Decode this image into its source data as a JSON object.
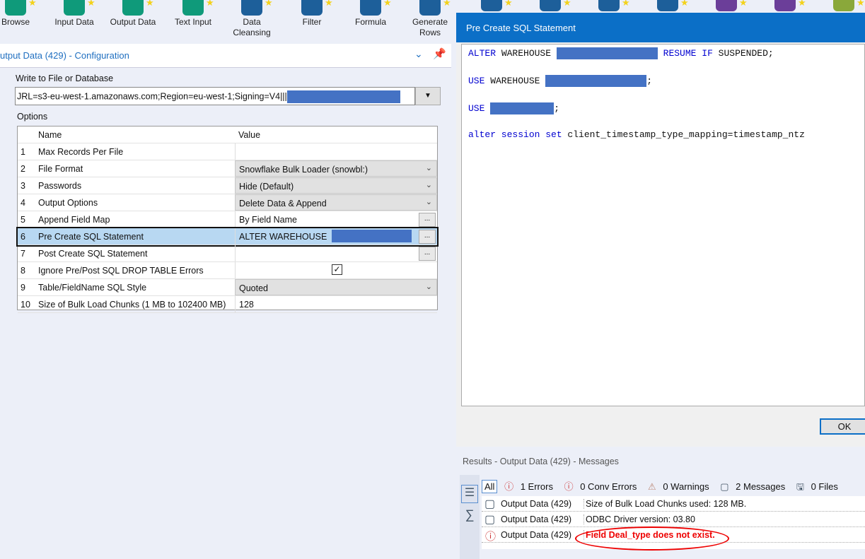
{
  "toolbar": {
    "tools": [
      {
        "label": "Browse",
        "color": "#0f9a7a"
      },
      {
        "label": "Input Data",
        "color": "#0f9a7a"
      },
      {
        "label": "Output Data",
        "color": "#0f9a7a"
      },
      {
        "label": "Text Input",
        "color": "#0f9a7a"
      },
      {
        "label": "Data Cleansing",
        "color": "#1d5f9a"
      },
      {
        "label": "Filter",
        "color": "#1d5f9a"
      },
      {
        "label": "Formula",
        "color": "#1d5f9a"
      },
      {
        "label": "Generate Rows",
        "color": "#1d5f9a"
      }
    ]
  },
  "config": {
    "title": "utput Data (429) - Configuration",
    "write_label": "Write to File or Database",
    "connection": "JRL=s3-eu-west-1.amazonaws.com;Region=eu-west-1;Signing=V4|||",
    "options_label": "Options",
    "col_name": "Name",
    "col_value": "Value",
    "rows": [
      {
        "n": "1",
        "name": "Max Records Per File",
        "value": ""
      },
      {
        "n": "2",
        "name": "File Format",
        "value": "Snowflake Bulk Loader (snowbl:)"
      },
      {
        "n": "3",
        "name": "Passwords",
        "value": "Hide (Default)"
      },
      {
        "n": "4",
        "name": "Output Options",
        "value": "Delete Data & Append"
      },
      {
        "n": "5",
        "name": "Append Field Map",
        "value": "By Field Name"
      },
      {
        "n": "6",
        "name": "Pre Create SQL Statement",
        "value": "ALTER  WAREHOUSE"
      },
      {
        "n": "7",
        "name": "Post Create SQL Statement",
        "value": ""
      },
      {
        "n": "8",
        "name": "Ignore Pre/Post SQL DROP TABLE Errors",
        "value": "checked"
      },
      {
        "n": "9",
        "name": "Table/FieldName SQL Style",
        "value": "Quoted"
      },
      {
        "n": "10",
        "name": "Size of Bulk Load Chunks (1 MB to 102400 MB)",
        "value": "128"
      }
    ]
  },
  "dialog": {
    "title": "Pre Create SQL Statement",
    "ok": "OK",
    "l1a": "ALTER",
    "l1b": " WAREHOUSE ",
    "l1c": "RESUME IF",
    "l1d": " SUSPENDED;",
    "l2a": "USE",
    "l2b": " WAREHOUSE ",
    "l2c": ";",
    "l3a": "USE",
    "l3b": ";",
    "l4a": "alter session set",
    "l4b": " client_timestamp_type_mapping=timestamp_ntz"
  },
  "results": {
    "title": "Results - Output Data (429) - Messages",
    "all": "All",
    "errors": "1 Errors",
    "conv": "0 Conv Errors",
    "warnings": "0 Warnings",
    "messages": "2 Messages",
    "files": "0 Files",
    "rows": [
      {
        "src": "Output Data (429)",
        "msg": "Size of Bulk Load Chunks used: 128 MB."
      },
      {
        "src": "Output Data (429)",
        "msg": "ODBC Driver version: 03.80"
      },
      {
        "src": "Output Data (429)",
        "msg": "Field Deal_type does not exist."
      }
    ]
  }
}
